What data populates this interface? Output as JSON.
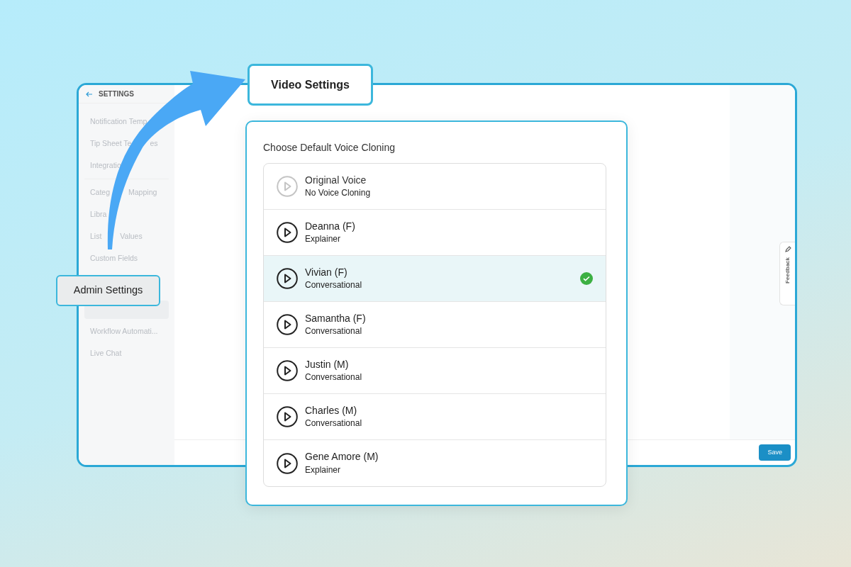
{
  "app": {
    "back_label": "SETTINGS",
    "sidebar_items": [
      {
        "label": "Notification Temp",
        "selected": false
      },
      {
        "label": "Tip Sheet Te",
        "tail": "es",
        "selected": false
      },
      {
        "label": "Integratio",
        "selected": false,
        "divider_after": true
      },
      {
        "label": "Categ",
        "tail": "Mapping",
        "selected": false
      },
      {
        "label": "Libra",
        "selected": false
      },
      {
        "label": "List",
        "tail": "Values",
        "selected": false
      },
      {
        "label": "Custom Fields",
        "selected": false
      },
      {
        "selected": true
      },
      {
        "label": "Workflow Automati...",
        "selected": false
      },
      {
        "label": "Live Chat",
        "selected": false
      }
    ],
    "feedback_label": "Feedback",
    "save_label": "Save"
  },
  "callouts": {
    "video": "Video Settings",
    "admin": "Admin Settings"
  },
  "voice_card": {
    "title": "Choose Default Voice Cloning",
    "voices": [
      {
        "name": "Original Voice",
        "style": "No Voice Cloning",
        "disabled": true,
        "selected": false
      },
      {
        "name": "Deanna (F)",
        "style": "Explainer",
        "disabled": false,
        "selected": false
      },
      {
        "name": "Vivian (F)",
        "style": "Conversational",
        "disabled": false,
        "selected": true
      },
      {
        "name": "Samantha (F)",
        "style": "Conversational",
        "disabled": false,
        "selected": false
      },
      {
        "name": "Justin (M)",
        "style": "Conversational",
        "disabled": false,
        "selected": false
      },
      {
        "name": "Charles (M)",
        "style": "Conversational",
        "disabled": false,
        "selected": false
      },
      {
        "name": "Gene Amore (M)",
        "style": "Explainer",
        "disabled": false,
        "selected": false
      }
    ]
  }
}
